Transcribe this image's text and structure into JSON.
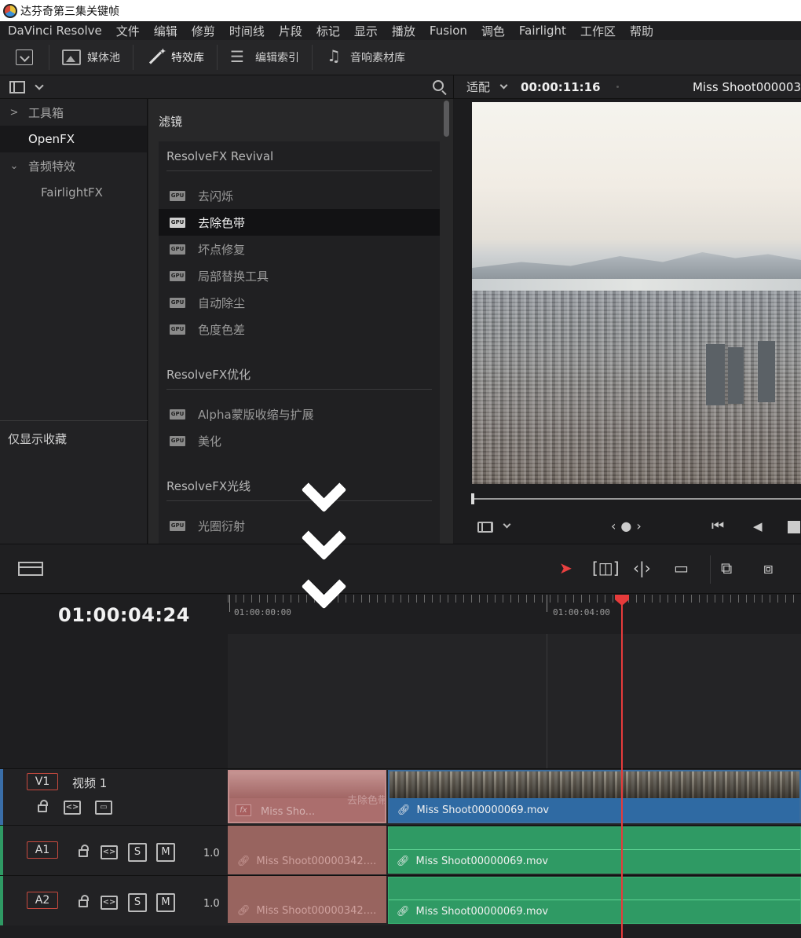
{
  "window": {
    "title": "达芬奇第三集关键帧"
  },
  "menu": [
    "DaVinci Resolve",
    "文件",
    "编辑",
    "修剪",
    "时间线",
    "片段",
    "标记",
    "显示",
    "播放",
    "Fusion",
    "调色",
    "Fairlight",
    "工作区",
    "帮助"
  ],
  "toolbar": {
    "media_pool": "媒体池",
    "effects_library": "特效库",
    "edit_index": "编辑索引",
    "sound_library": "音响素材库"
  },
  "sidebar": {
    "items": [
      {
        "label": "工具箱",
        "arrow": ">"
      },
      {
        "label": "OpenFX",
        "arrow": ""
      },
      {
        "label": "音频特效",
        "arrow": "⌄"
      },
      {
        "label": "FairlightFX",
        "arrow": ""
      }
    ],
    "favorites_only": "仅显示收藏"
  },
  "fx_panel": {
    "heading": "滤镜",
    "categories": [
      {
        "name": "ResolveFX Revival",
        "items": [
          "去闪烁",
          "去除色带",
          "坏点修复",
          "局部替换工具",
          "自动除尘",
          "色度色差"
        ]
      },
      {
        "name": "ResolveFX优化",
        "items": [
          "Alpha蒙版收缩与扩展",
          "美化"
        ]
      },
      {
        "name": "ResolveFX光线",
        "items": [
          "光圈衍射"
        ]
      }
    ],
    "selected": "去除色带",
    "gpu_badge": "GPU"
  },
  "viewer": {
    "fit": "适配",
    "timecode": "00:00:11:16",
    "clip_name": "Miss Shoot000003"
  },
  "timeline": {
    "timecode": "01:00:04:24",
    "ruler_labels": [
      "01:00:00:00",
      "01:00:04:00"
    ],
    "tracks": {
      "v1": {
        "badge": "V1",
        "name": "视频 1"
      },
      "a1": {
        "badge": "A1",
        "volume": "1.0",
        "solo": "S",
        "mute": "M"
      },
      "a2": {
        "badge": "A2",
        "volume": "1.0",
        "solo": "S",
        "mute": "M"
      }
    },
    "clips": {
      "video_main": "Miss Shoot00000069.mov",
      "video_ghost": "Miss Sho...",
      "ghost_effect": "去除色带",
      "audio_a1_ghost": "Miss Shoot00000342....",
      "audio_a1": "Miss Shoot00000069.mov",
      "audio_a2_ghost": "Miss Shoot00000342....",
      "audio_a2": "Miss Shoot00000069.mov"
    }
  },
  "colors": {
    "accent_red": "#e63b3b",
    "video_clip": "#2f6aa3",
    "audio_clip": "#2f9a64"
  }
}
